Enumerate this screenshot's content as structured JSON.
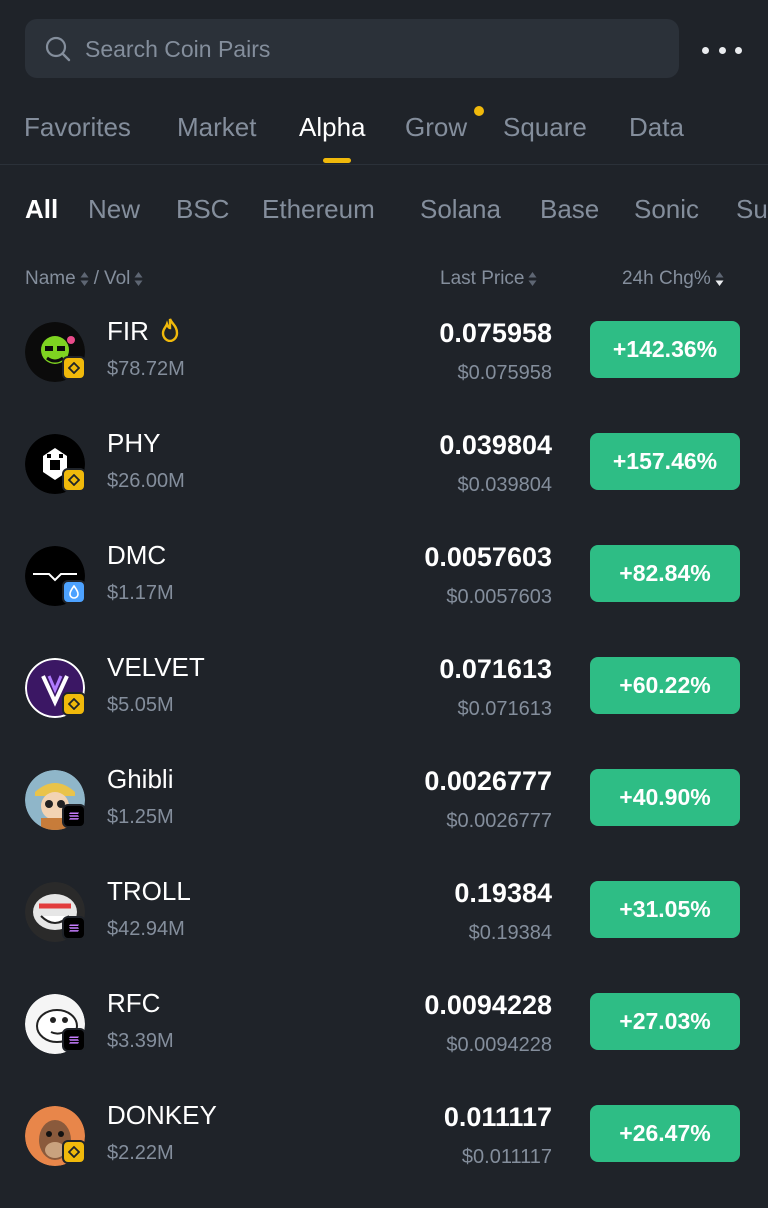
{
  "search": {
    "placeholder": "Search Coin Pairs"
  },
  "main_tabs": [
    {
      "label": "Favorites"
    },
    {
      "label": "Market"
    },
    {
      "label": "Alpha"
    },
    {
      "label": "Grow"
    },
    {
      "label": "Square"
    },
    {
      "label": "Data"
    }
  ],
  "active_main_tab": "Alpha",
  "chain_tabs": [
    {
      "label": "All"
    },
    {
      "label": "New"
    },
    {
      "label": "BSC"
    },
    {
      "label": "Ethereum"
    },
    {
      "label": "Solana"
    },
    {
      "label": "Base"
    },
    {
      "label": "Sonic"
    },
    {
      "label": "Su"
    }
  ],
  "headers": {
    "name": "Name",
    "slash": "/",
    "vol": "Vol",
    "last_price": "Last Price",
    "chg": "24h Chg%"
  },
  "coins": [
    {
      "name": "FIR",
      "vol": "$78.72M",
      "price": "0.075958",
      "usd": "$0.075958",
      "chg": "+142.36%",
      "chain": "bnb"
    },
    {
      "name": "PHY",
      "vol": "$26.00M",
      "price": "0.039804",
      "usd": "$0.039804",
      "chg": "+157.46%",
      "chain": "bnb"
    },
    {
      "name": "DMC",
      "vol": "$1.17M",
      "price": "0.0057603",
      "usd": "$0.0057603",
      "chg": "+82.84%",
      "chain": "sui"
    },
    {
      "name": "VELVET",
      "vol": "$5.05M",
      "price": "0.071613",
      "usd": "$0.071613",
      "chg": "+60.22%",
      "chain": "bnb"
    },
    {
      "name": "Ghibli",
      "vol": "$1.25M",
      "price": "0.0026777",
      "usd": "$0.0026777",
      "chg": "+40.90%",
      "chain": "solana"
    },
    {
      "name": "TROLL",
      "vol": "$42.94M",
      "price": "0.19384",
      "usd": "$0.19384",
      "chg": "+31.05%",
      "chain": "solana"
    },
    {
      "name": "RFC",
      "vol": "$3.39M",
      "price": "0.0094228",
      "usd": "$0.0094228",
      "chg": "+27.03%",
      "chain": "solana"
    },
    {
      "name": "DONKEY",
      "vol": "$2.22M",
      "price": "0.011117",
      "usd": "$0.011117",
      "chg": "+26.47%",
      "chain": "bnb"
    }
  ],
  "colors": {
    "background": "#1f2329",
    "accent": "#f0b90b",
    "positive": "#2ebd85",
    "muted": "#848e9c"
  }
}
